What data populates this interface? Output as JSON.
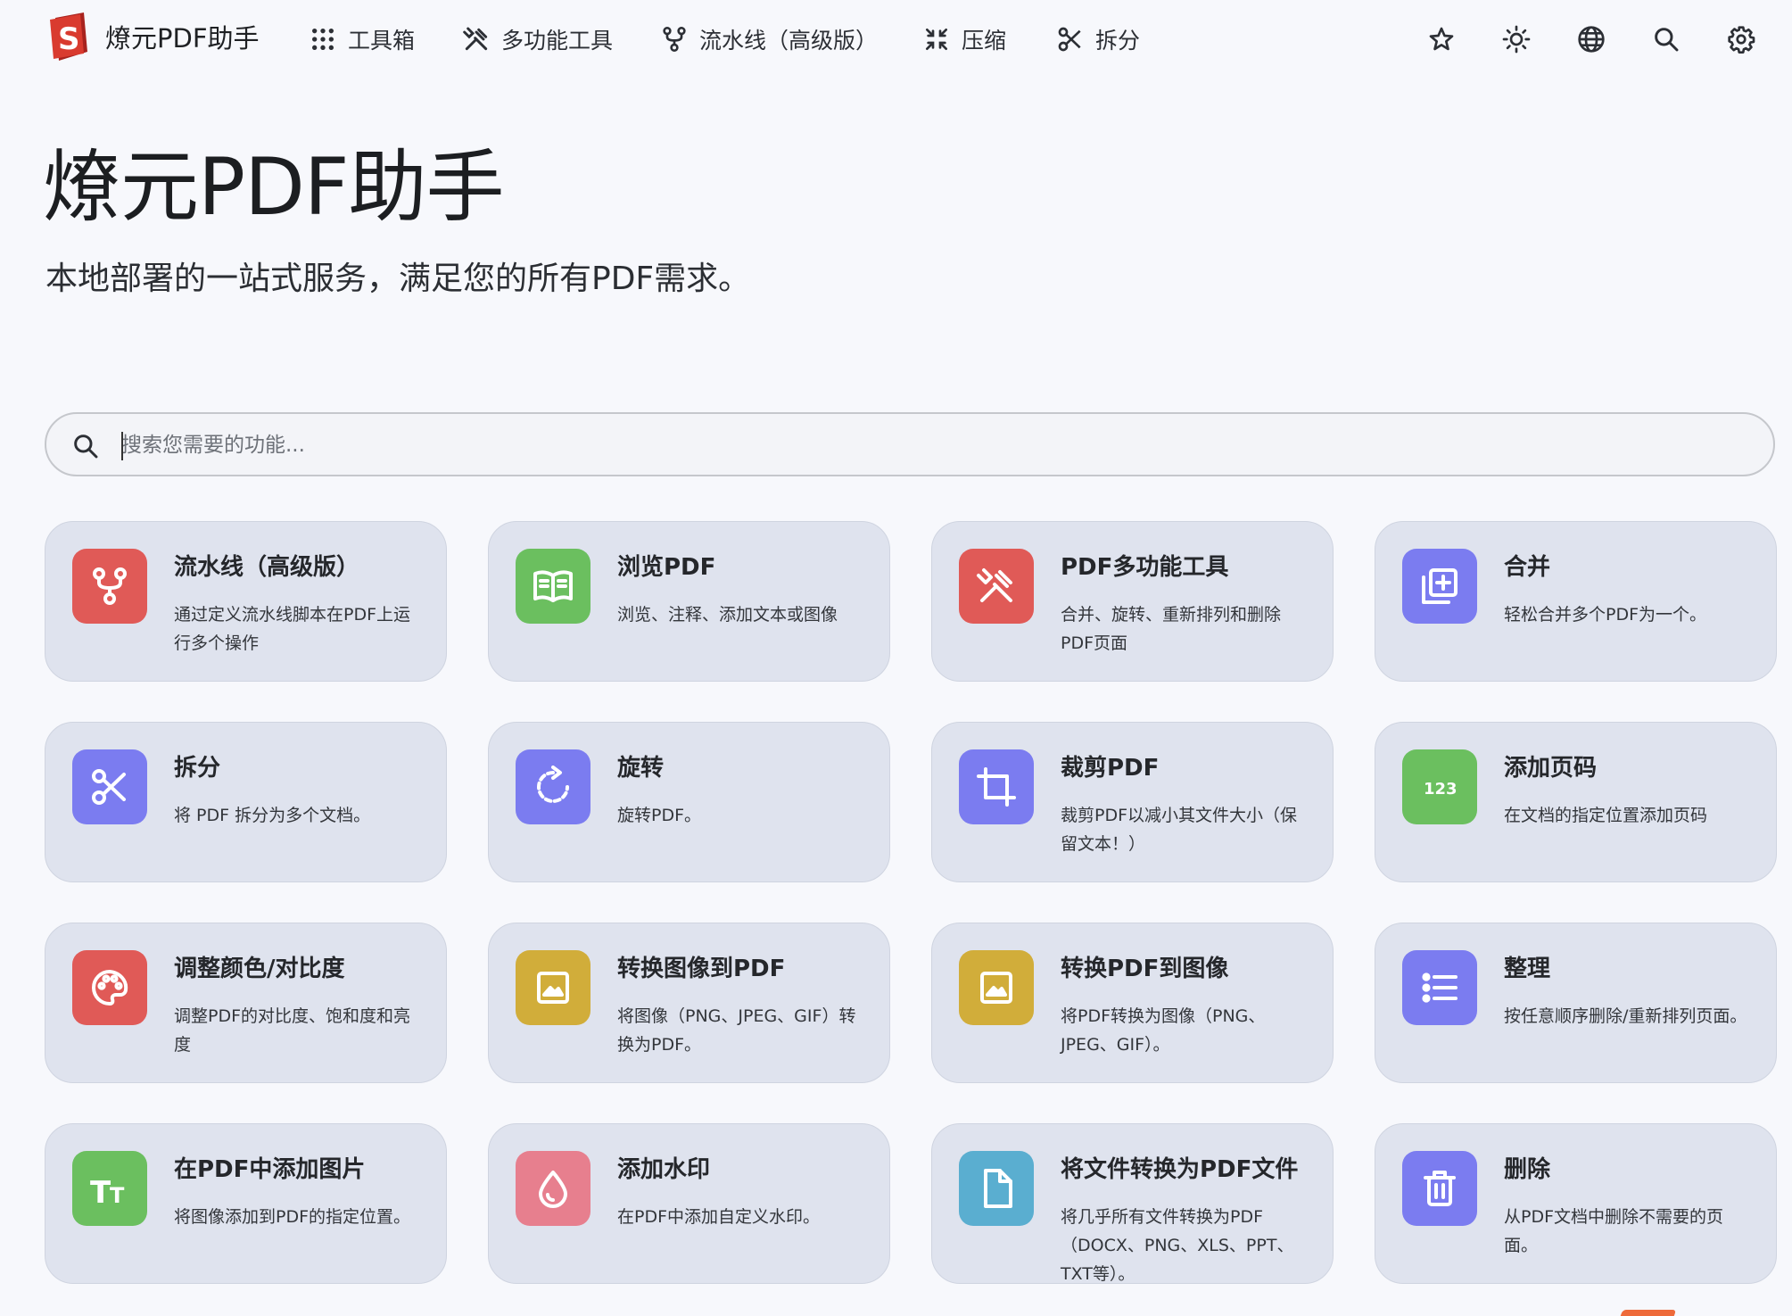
{
  "brand": {
    "name": "燎元PDF助手",
    "logo_letter": "S"
  },
  "nav": {
    "items": [
      {
        "label": "工具箱",
        "icon": "grid-dots-icon"
      },
      {
        "label": "多功能工具",
        "icon": "tools-icon"
      },
      {
        "label": "流水线（高级版）",
        "icon": "pipeline-icon"
      },
      {
        "label": "压缩",
        "icon": "compress-icon"
      },
      {
        "label": "拆分",
        "icon": "scissors-icon"
      }
    ],
    "right_icons": [
      "star-icon",
      "sun-icon",
      "globe-icon",
      "search-icon",
      "gear-icon"
    ]
  },
  "hero": {
    "title": "燎元PDF助手",
    "subtitle": "本地部署的一站式服务，满足您的所有PDF需求。"
  },
  "search": {
    "placeholder": "搜索您需要的功能...",
    "value": ""
  },
  "cards": [
    {
      "title": "流水线（高级版）",
      "desc": "通过定义流水线脚本在PDF上运行多个操作",
      "icon": "pipeline-icon",
      "color": "#e05a57"
    },
    {
      "title": "浏览PDF",
      "desc": "浏览、注释、添加文本或图像",
      "icon": "book-icon",
      "color": "#6bbf5f"
    },
    {
      "title": "PDF多功能工具",
      "desc": "合并、旋转、重新排列和删除PDF页面",
      "icon": "tools-icon",
      "color": "#e05a57"
    },
    {
      "title": "合并",
      "desc": "轻松合并多个PDF为一个。",
      "icon": "merge-icon",
      "color": "#7b7cf0"
    },
    {
      "title": "拆分",
      "desc": "将 PDF 拆分为多个文档。",
      "icon": "scissors-icon",
      "color": "#7b7cf0"
    },
    {
      "title": "旋转",
      "desc": "旋转PDF。",
      "icon": "rotate-icon",
      "color": "#7b7cf0"
    },
    {
      "title": "裁剪PDF",
      "desc": "裁剪PDF以减小其文件大小（保留文本！）",
      "icon": "crop-icon",
      "color": "#7b7cf0"
    },
    {
      "title": "添加页码",
      "desc": "在文档的指定位置添加页码",
      "icon": "numbers-icon",
      "color": "#6bbf5f"
    },
    {
      "title": "调整颜色/对比度",
      "desc": "调整PDF的对比度、饱和度和亮度",
      "icon": "palette-icon",
      "color": "#e05a57"
    },
    {
      "title": "转换图像到PDF",
      "desc": "将图像（PNG、JPEG、GIF）转换为PDF。",
      "icon": "image-icon",
      "color": "#d1ad3a"
    },
    {
      "title": "转换PDF到图像",
      "desc": "将PDF转换为图像（PNG、JPEG、GIF）。",
      "icon": "image-icon",
      "color": "#d1ad3a"
    },
    {
      "title": "整理",
      "desc": "按任意顺序删除/重新排列页面。",
      "icon": "list-icon",
      "color": "#7b7cf0"
    },
    {
      "title": "在PDF中添加图片",
      "desc": "将图像添加到PDF的指定位置。",
      "icon": "text-size-icon",
      "color": "#6bbf5f"
    },
    {
      "title": "添加水印",
      "desc": "在PDF中添加自定义水印。",
      "icon": "droplet-icon",
      "color": "#e77f8e"
    },
    {
      "title": "将文件转换为PDF文件",
      "desc": "将几乎所有文件转换为PDF（DOCX、PNG、XLS、PPT、TXT等）。",
      "icon": "file-icon",
      "color": "#5aaed0"
    },
    {
      "title": "删除",
      "desc": "从PDF文档中删除不需要的页面。",
      "icon": "trash-icon",
      "color": "#7b7cf0"
    }
  ]
}
